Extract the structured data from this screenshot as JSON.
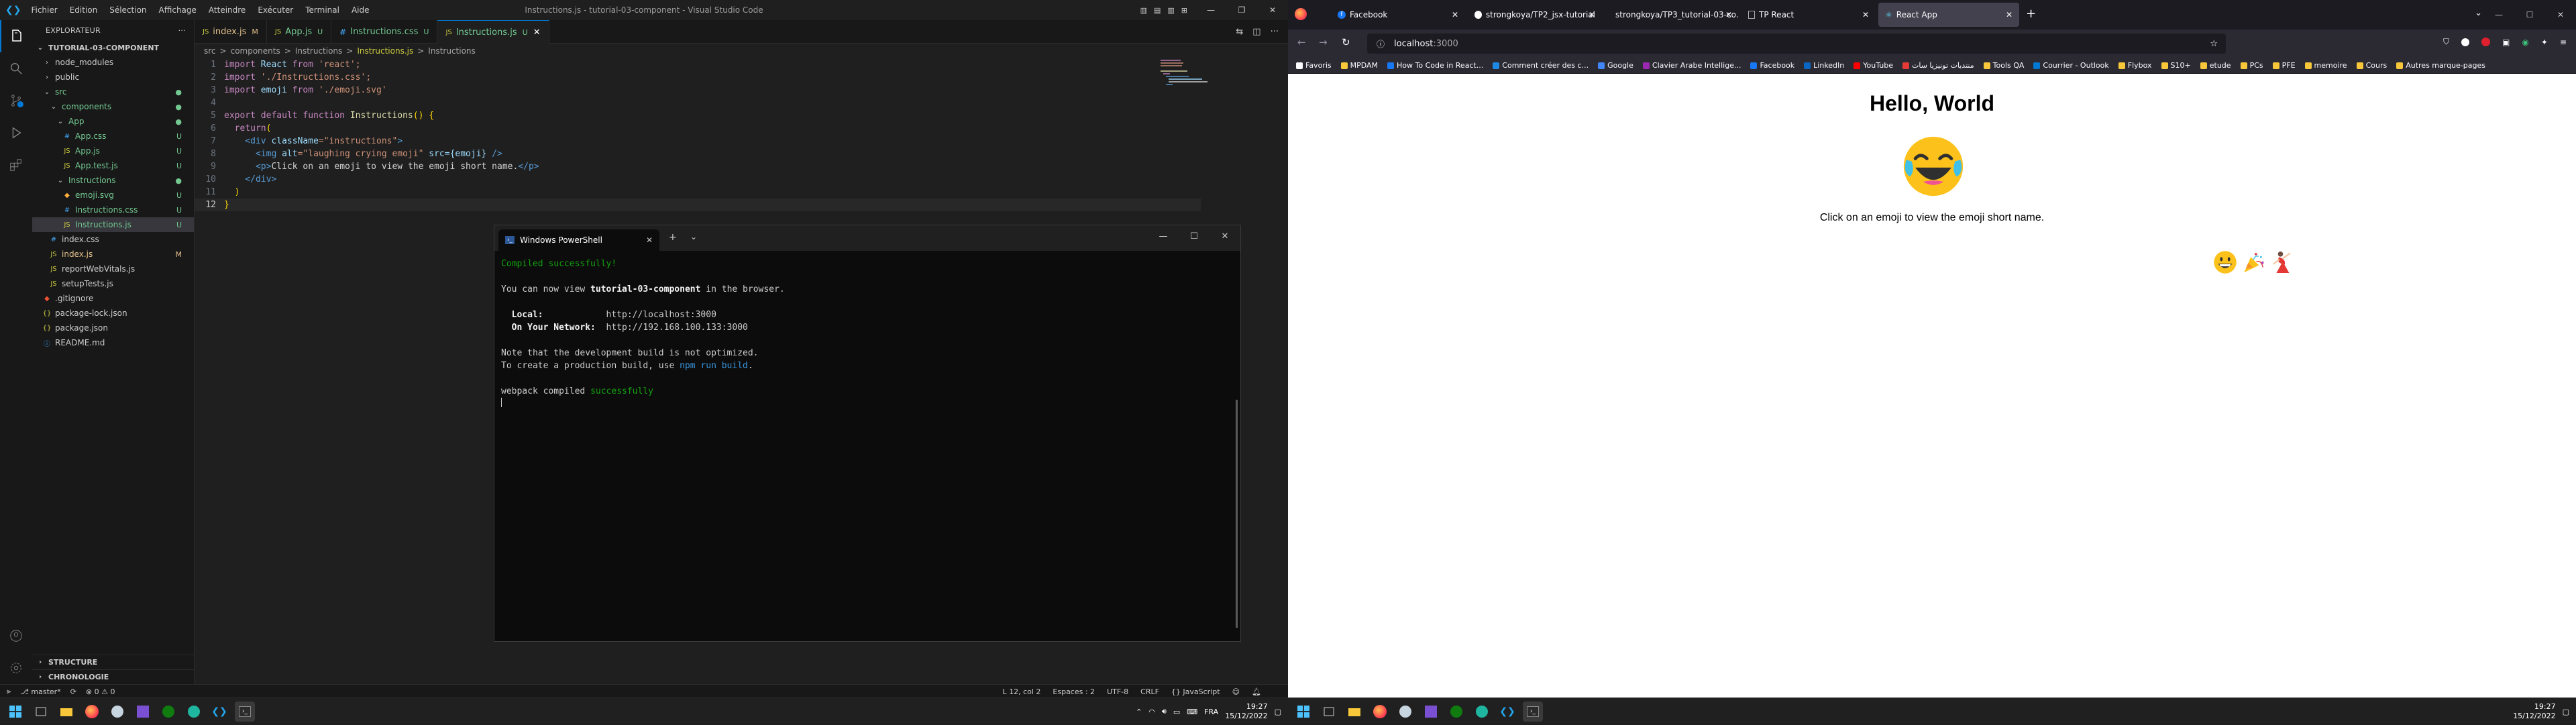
{
  "vscode": {
    "window_title": "Instructions.js - tutorial-03-component - Visual Studio Code",
    "menu": [
      "Fichier",
      "Edition",
      "Sélection",
      "Affichage",
      "Atteindre",
      "Exécuter",
      "Terminal",
      "Aide"
    ],
    "sidebar": {
      "title": "EXPLORATEUR",
      "root": "TUTORIAL-03-COMPONENT",
      "tree": [
        {
          "label": "node_modules",
          "badge": "",
          "kind": "folder"
        },
        {
          "label": "public",
          "badge": "",
          "kind": "folder"
        },
        {
          "label": "src",
          "badge": "●",
          "kind": "folder"
        },
        {
          "label": "components",
          "badge": "●",
          "kind": "folder"
        },
        {
          "label": "App",
          "badge": "●",
          "kind": "folder"
        },
        {
          "label": "App.css",
          "badge": "U",
          "kind": "css"
        },
        {
          "label": "App.js",
          "badge": "U",
          "kind": "js"
        },
        {
          "label": "App.test.js",
          "badge": "U",
          "kind": "js"
        },
        {
          "label": "Instructions",
          "badge": "●",
          "kind": "folder"
        },
        {
          "label": "emoji.svg",
          "badge": "U",
          "kind": "svg"
        },
        {
          "label": "Instructions.css",
          "badge": "U",
          "kind": "css"
        },
        {
          "label": "Instructions.js",
          "badge": "U",
          "kind": "js"
        },
        {
          "label": "index.css",
          "badge": "",
          "kind": "css"
        },
        {
          "label": "index.js",
          "badge": "M",
          "kind": "js"
        },
        {
          "label": "reportWebVitals.js",
          "badge": "",
          "kind": "js"
        },
        {
          "label": "setupTests.js",
          "badge": "",
          "kind": "js"
        },
        {
          "label": ".gitignore",
          "badge": "",
          "kind": "git"
        },
        {
          "label": "package-lock.json",
          "badge": "",
          "kind": "json"
        },
        {
          "label": "package.json",
          "badge": "",
          "kind": "json"
        },
        {
          "label": "README.md",
          "badge": "",
          "kind": "md"
        }
      ],
      "structure": "STRUCTURE",
      "timeline": "CHRONOLOGIE"
    },
    "tabs": [
      {
        "label": "index.js",
        "mark": "M"
      },
      {
        "label": "App.js",
        "mark": "U"
      },
      {
        "label": "Instructions.css",
        "mark": "U"
      },
      {
        "label": "Instructions.js",
        "mark": "U"
      }
    ],
    "breadcrumb": [
      "src",
      ">",
      "components",
      ">",
      "Instructions",
      ">",
      "Instructions.js",
      ">",
      "Instructions"
    ],
    "code_lines": [
      "1",
      "2",
      "3",
      "4",
      "5",
      "6",
      "7",
      "8",
      "9",
      "10",
      "11",
      "12"
    ],
    "code": {
      "l1a": "import",
      "l1b": " React ",
      "l1c": "from",
      "l1d": " 'react';",
      "l2a": "import",
      "l2b": " './Instructions.css';",
      "l3a": "import",
      "l3b": " emoji ",
      "l3c": "from",
      "l3d": " './emoji.svg'",
      "l5a": "export default function",
      "l5b": " Instructions",
      "l5c": "() {",
      "l6a": "  return",
      "l6b": "(",
      "l7a": "    <div",
      "l7b": " className",
      "l7c": "=\"instructions\"",
      "l7d": ">",
      "l8a": "      <img",
      "l8b": " alt",
      "l8c": "=\"laughing crying emoji\"",
      "l8d": " src",
      "l8e": "={emoji}",
      "l8f": " />",
      "l9a": "      <p>",
      "l9b": "Click on an emoji to view the emoji short name.",
      "l9c": "</p>",
      "l10a": "    </div>",
      "l11a": "  )",
      "l12a": "}"
    },
    "status": {
      "branch": "master*",
      "problems": "⊗ 0 ⚠ 0",
      "position": "L 12, col 2",
      "spaces": "Espaces : 2",
      "encoding": "UTF-8",
      "eol": "CRLF",
      "language": "{} JavaScript"
    }
  },
  "terminal": {
    "tab_title": "Windows PowerShell",
    "lines": {
      "compiled": "Compiled successfully!",
      "view_a": "You can now view ",
      "view_b": "tutorial-03-component",
      "view_c": " in the browser.",
      "local_k": "  Local:            ",
      "local_v": "http://localhost:3000",
      "net_k": "  On Your Network:  ",
      "net_v": "http://192.168.100.133:3000",
      "note1": "Note that the development build is not optimized.",
      "note2a": "To create a production build, use ",
      "note2b": "npm run build",
      "note2c": ".",
      "wp_a": "webpack compiled ",
      "wp_b": "successfully"
    }
  },
  "browser": {
    "tabs": [
      {
        "label": "Facebook"
      },
      {
        "label": "strongkoya/TP2_jsx-tutorial"
      },
      {
        "label": "strongkoya/TP3_tutorial-03-co..."
      },
      {
        "label": "TP React"
      },
      {
        "label": "React App"
      }
    ],
    "url_host": "localhost",
    "url_port": ":3000",
    "bookmarks": [
      "Favoris",
      "MPDAM",
      "How To Code in React...",
      "Comment créer des c...",
      "Google",
      "Clavier Arabe Intellige...",
      "Facebook",
      "LinkedIn",
      "YouTube",
      "منتديات تونيزيا سات",
      "Tools QA",
      "Courrier - Outlook",
      "Flybox",
      "S10+",
      "etude",
      "PCs",
      "PFE",
      "memoire",
      "Cours",
      "Autres marque-pages"
    ],
    "page": {
      "heading": "Hello, World",
      "instruction": "Click on an emoji to view the emoji short name."
    }
  },
  "taskbar": {
    "lang": "FRA",
    "time": "19:27",
    "date": "15/12/2022"
  }
}
